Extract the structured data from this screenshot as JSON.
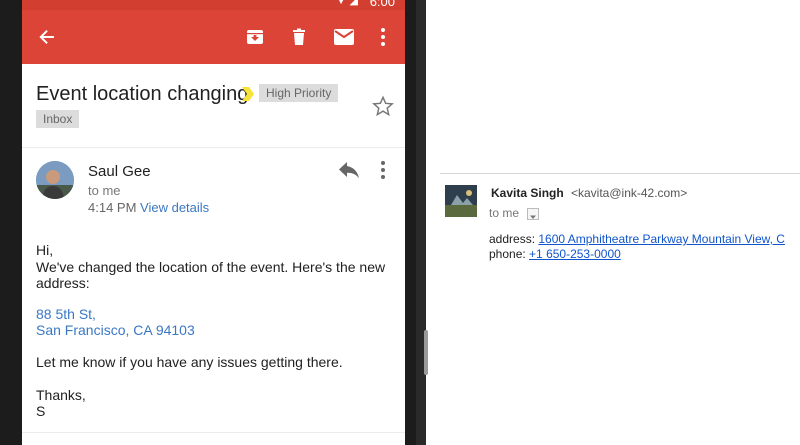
{
  "status_bar": {
    "time": "6:00"
  },
  "email": {
    "subject": "Event location changing",
    "priority_label": "High Priority",
    "inbox_label": "Inbox",
    "sender": "Saul Gee",
    "recipient": "to me",
    "time": "4:14 PM",
    "view_details": "View details",
    "greeting": "Hi,",
    "message_line1": "We've changed the location of the event. Here's the new",
    "message_line2": "address:",
    "address_line1": "88 5th St,",
    "address_line2": "San Francisco, CA 94103",
    "closing_line": "Let me know if you have any issues getting there.",
    "signoff": "Thanks,",
    "signature": "S"
  },
  "desktop_email": {
    "sender_name": "Kavita Singh",
    "sender_email": "<kavita@ink-42.com>",
    "recipient": "to me",
    "address_label": "address:",
    "address_value": "1600 Amphitheatre Parkway Mountain View, C",
    "phone_label": "phone:",
    "phone_value": "+1 650-253-0000"
  },
  "colors": {
    "app_bar": "#db4437",
    "status_bar": "#d23f31",
    "link": "#3b78c4",
    "priority_marker": "#f6e23a"
  },
  "icons": {
    "back": "back-arrow-icon",
    "archive": "archive-icon",
    "delete": "trash-icon",
    "mark_unread": "mail-icon",
    "more": "more-vert-icon",
    "star": "star-icon",
    "reply": "reply-icon"
  }
}
